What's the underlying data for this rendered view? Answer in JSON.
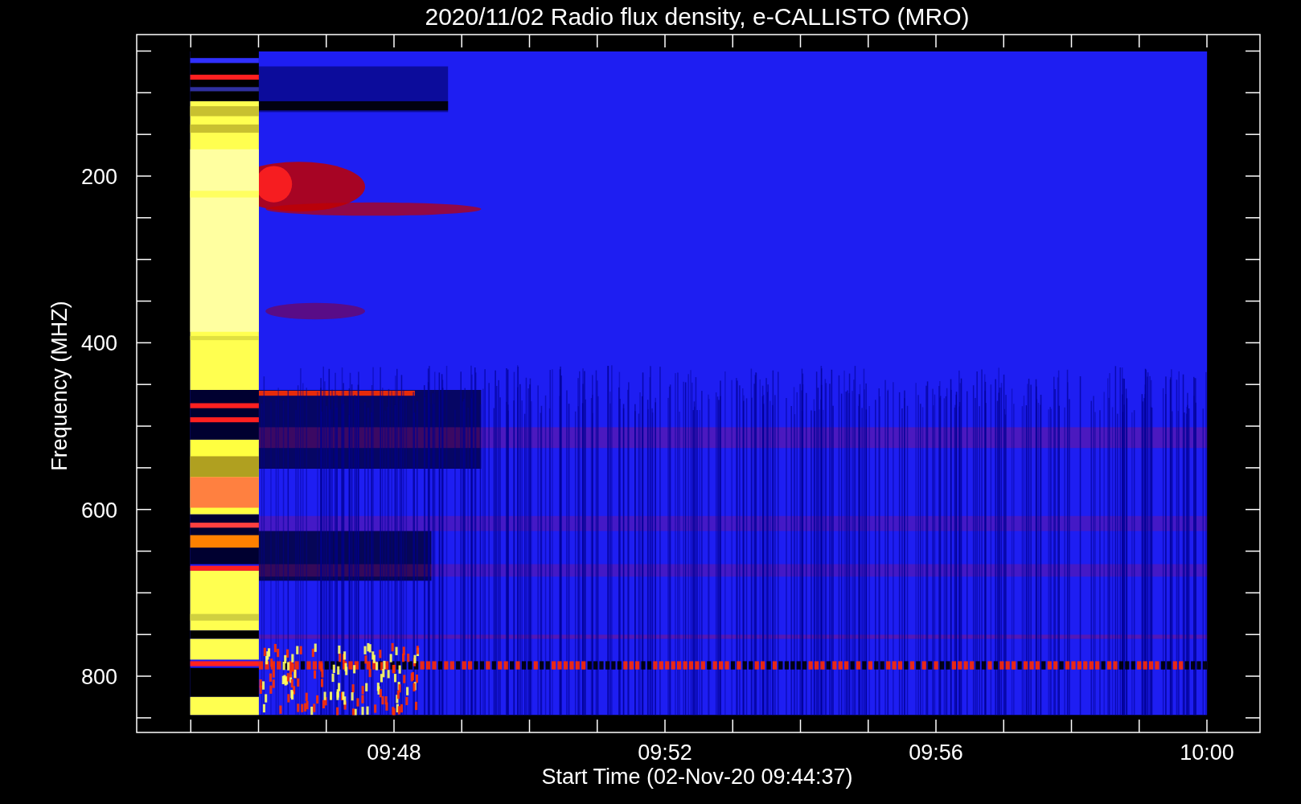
{
  "title": "2020/11/02  Radio flux density, e-CALLISTO (MRO)",
  "ylabel": "Frequency (MHZ)",
  "xlabel": "Start Time (02-Nov-20 09:44:37)",
  "yticks": [
    "200",
    "400",
    "600",
    "800"
  ],
  "xticks": [
    "09:48",
    "09:52",
    "09:56",
    "10:00"
  ]
}
